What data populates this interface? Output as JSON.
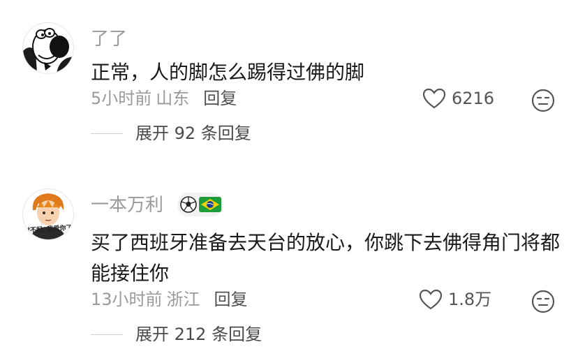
{
  "comments": [
    {
      "username": "了了",
      "text": "正常，人的脚怎么踢得过佛的脚",
      "time": "5小时前",
      "location": "山东",
      "reply_label": "回复",
      "likes": "6216",
      "expand_label": "展开 92 条回复",
      "avatar_icon": "cartoon-dog-avatar"
    },
    {
      "username": "一本万利",
      "badge_icons": [
        "soccer-ball-icon",
        "brazil-flag-icon"
      ],
      "text": "买了西班牙准备去天台的放心，你跳下去佛得角门将都能接住你",
      "time": "13小时前",
      "location": "浙江",
      "reply_label": "回复",
      "likes": "1.8万",
      "expand_label": "展开 212 条回复",
      "avatar_icon": "anime-boy-avatar",
      "avatar_caption": "对不起, 我爱你了"
    }
  ],
  "colors": {
    "username": "#9a9a9a",
    "text": "#1a1a1a",
    "meta": "#9a9a9a"
  }
}
